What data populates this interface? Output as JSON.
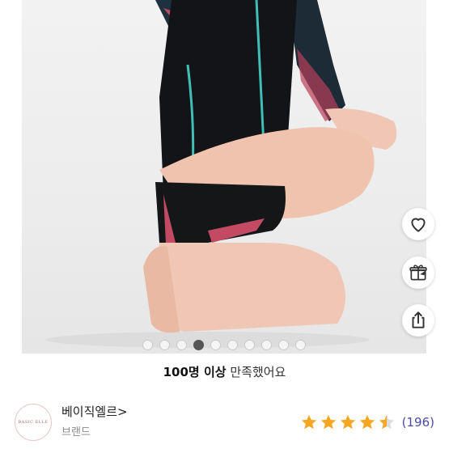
{
  "product": {
    "image_alt": "product photo",
    "carousel": {
      "total": 10,
      "active_index": 3
    }
  },
  "actions": {
    "like_icon": "heart-icon",
    "gift_icon": "gift-icon",
    "share_icon": "share-icon"
  },
  "satisfaction": {
    "count_text": "100명 이상",
    "suffix_text": "만족했어요"
  },
  "brand": {
    "logo_text": "BASIC ELLE",
    "name": "베이직엘르",
    "chevron": ">",
    "label": "브랜드"
  },
  "rating": {
    "stars": 4.5,
    "star_color": "#f5a623",
    "count_text": "(196)"
  }
}
